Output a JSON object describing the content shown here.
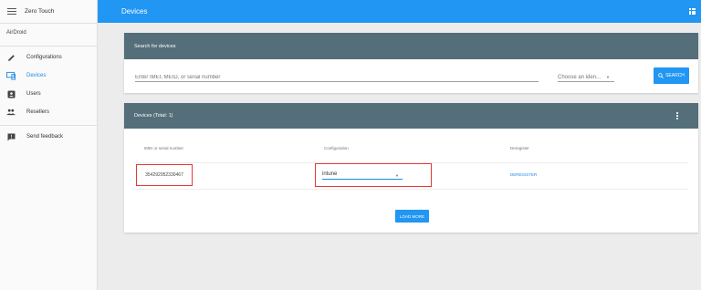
{
  "sidebar": {
    "app_name": "Zero Touch",
    "org_name": "AirDroid",
    "items": [
      {
        "label": "Configurations",
        "icon": "pencil-icon"
      },
      {
        "label": "Devices",
        "icon": "devices-icon",
        "active": true
      },
      {
        "label": "Users",
        "icon": "user-badge-icon"
      },
      {
        "label": "Resellers",
        "icon": "people-icon"
      },
      {
        "label": "Send feedback",
        "icon": "feedback-icon"
      }
    ]
  },
  "header": {
    "title": "Devices",
    "apps_icon": "apps-grid-icon"
  },
  "search": {
    "heading": "Search for devices",
    "placeholder": "Enter IMEI, MEID, or serial number",
    "identifier_select": "Choose an iden...",
    "button_label": "SEARCH"
  },
  "devices": {
    "heading": "Devices (Total: 1)",
    "columns": [
      "IMEI or serial number",
      "Configuration",
      "Deregister"
    ],
    "rows": [
      {
        "imei": "354292952330467",
        "configuration": "intune",
        "deregister": "DEREGISTER"
      }
    ],
    "load_more": "LOAD MORE"
  },
  "colors": {
    "primary": "#2196f3",
    "card_header": "#546e7a",
    "highlight_box": "#e53935"
  }
}
